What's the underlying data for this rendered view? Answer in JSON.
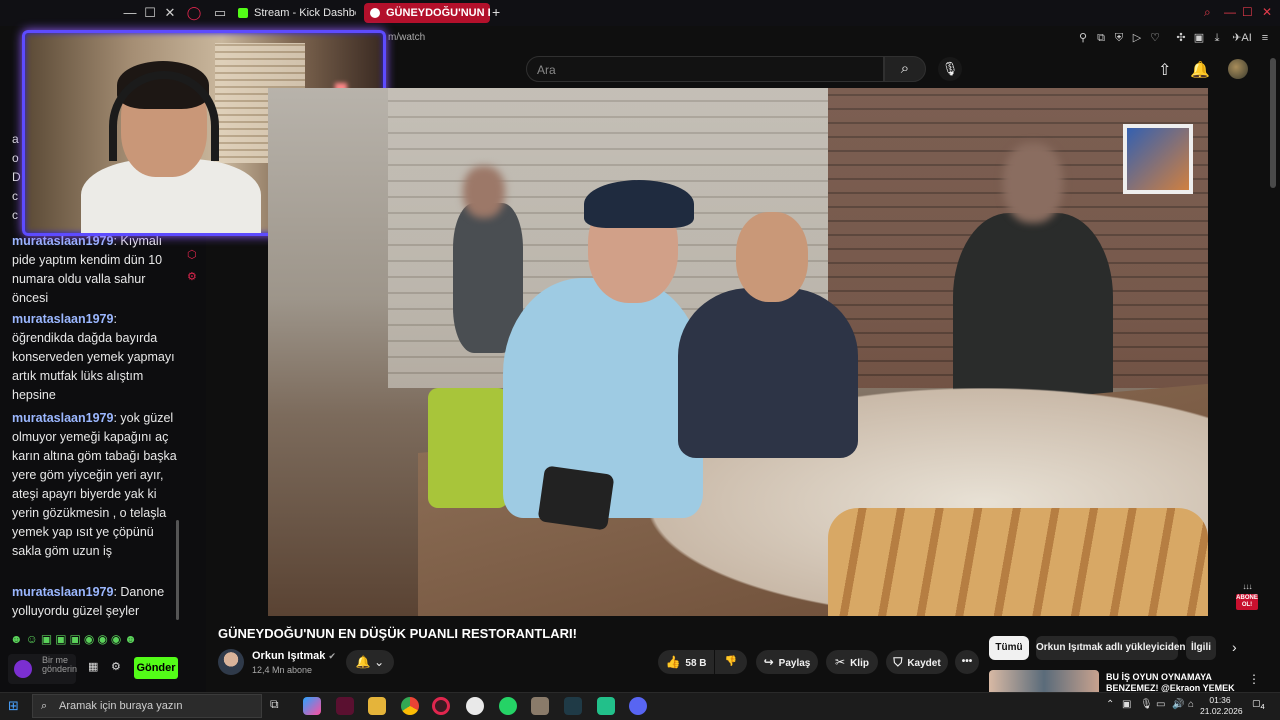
{
  "browser": {
    "tabs": [
      {
        "label": "Stream - Kick Dashboard"
      },
      {
        "label": "GÜNEYDOĞU'NUN EN"
      }
    ],
    "url_fragment": "m/watch",
    "new_tab": "+"
  },
  "youtube": {
    "search_placeholder": "Ara",
    "video_title": "GÜNEYDOĞU'NUN EN DÜŞÜK PUANLI RESTORANTLARI!",
    "channel": {
      "name": "Orkun Işıtmak",
      "subscribers": "12,4 Mn abone",
      "verified": "✔"
    },
    "actions": {
      "like_count": "58 B",
      "share": "Paylaş",
      "clip": "Klip",
      "save": "Kaydet",
      "more": "•••"
    },
    "chips": [
      "Tümü",
      "Orkun Işıtmak adlı yükleyiciden",
      "İlgili"
    ],
    "recommendation": {
      "title": "BU İŞ OYUN OYNAMAYA BENZEMEZ! @Ekraon YEMEK"
    },
    "overlay_badge": {
      "arrows": "↓↓↓",
      "text": "ABONE OL!"
    }
  },
  "chat": {
    "messages": [
      {
        "user": "murataslaan1979",
        "text": "Kıymalı pide yaptım kendim dün 10 numara oldu valla sahur öncesi"
      },
      {
        "user": "murataslaan1979",
        "text": "öğrendikda dağda bayırda konserveden yemek yapmayı artık mutfak lüks alıştım hepsine"
      },
      {
        "user": "murataslaan1979",
        "text": "yok güzel olmuyor yemeği kapağını aç karın altına göm tabağı başka yere göm yiyceğin yeri ayır, ateşi apayrı biyerde yak ki yerin gözükmesin , o telaşla yemek yap ısıt ye çöpünü sakla göm uzun iş"
      },
      {
        "user": "murataslaan1979",
        "text": "Danone yolluyordu güzel şeyler"
      }
    ],
    "partial_left_letters": [
      "a",
      "o",
      "D",
      "c",
      "c"
    ],
    "input_placeholder": "Bir me gönderin",
    "send_label": "Gönder",
    "emotes": "☻☺▣▣▣◉◉◉☻"
  },
  "taskbar": {
    "search_placeholder": "Aramak için buraya yazın",
    "time": "01:36",
    "date": "21.02.2026",
    "notification_count": "4"
  },
  "colors": {
    "kick_green": "#53fc18",
    "yt_red": "#c8102e",
    "active_tab": "#b3102b",
    "webcam_border": "#5d4bff",
    "username": "#9bb7ff"
  }
}
